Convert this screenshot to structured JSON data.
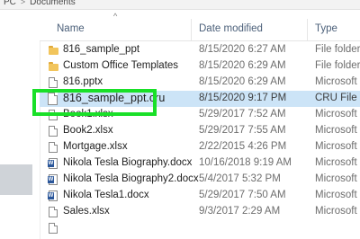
{
  "breadcrumb": {
    "pc": "PC",
    "separator": ">",
    "current": "Documents"
  },
  "columns": {
    "name": "Name",
    "date": "Date modified",
    "type": "Type",
    "sort_indicator": "^"
  },
  "files": [
    {
      "name": "816_sample_ppt",
      "date": "8/15/2020 6:27 AM",
      "type": "File folder",
      "icon": "folder-icon",
      "selected": false
    },
    {
      "name": "Custom Office Templates",
      "date": "8/15/2020 6:29 AM",
      "type": "File folder",
      "icon": "folder-icon",
      "selected": false
    },
    {
      "name": "816.pptx",
      "date": "8/15/2020 6:29 AM",
      "type": "Microsoft",
      "icon": "document-icon",
      "selected": false
    },
    {
      "name": "816_sample_ppt.cru",
      "date": "8/15/2020 9:17 PM",
      "type": "CRU File",
      "icon": "document-icon",
      "selected": true
    },
    {
      "name": "Book1.xlsx",
      "date": "5/29/2017 7:52 AM",
      "type": "Microsoft",
      "icon": "document-icon",
      "selected": false
    },
    {
      "name": "Book2.xlsx",
      "date": "5/29/2017 7:55 AM",
      "type": "Microsoft",
      "icon": "document-icon",
      "selected": false
    },
    {
      "name": "Mortgage.xlsx",
      "date": "2/22/2015 4:26 PM",
      "type": "Microsoft",
      "icon": "document-icon",
      "selected": false
    },
    {
      "name": "Nikola Tesla Biography.docx",
      "date": "10/16/2018 9:19 AM",
      "type": "Microsoft",
      "icon": "word-document-icon",
      "selected": false
    },
    {
      "name": "Nikola Tesla Biography2.docx",
      "date": "5/4/2017 5:32 PM",
      "type": "Microsoft",
      "icon": "word-document-icon",
      "selected": false
    },
    {
      "name": "Nikola Tesla1.docx",
      "date": "5/29/2017 7:50 AM",
      "type": "Microsoft",
      "icon": "word-document-icon",
      "selected": false
    },
    {
      "name": "Sales.xlsx",
      "date": "9/3/2017 2:29 AM",
      "type": "Microsoft",
      "icon": "document-icon",
      "selected": false
    },
    {
      "name": "",
      "date": "",
      "type": "",
      "icon": "document-icon",
      "selected": false
    }
  ],
  "colors": {
    "selection": "#cce4f7",
    "highlight_border": "#19e028",
    "folder": "#f2c55c",
    "word": "#2b579a"
  }
}
